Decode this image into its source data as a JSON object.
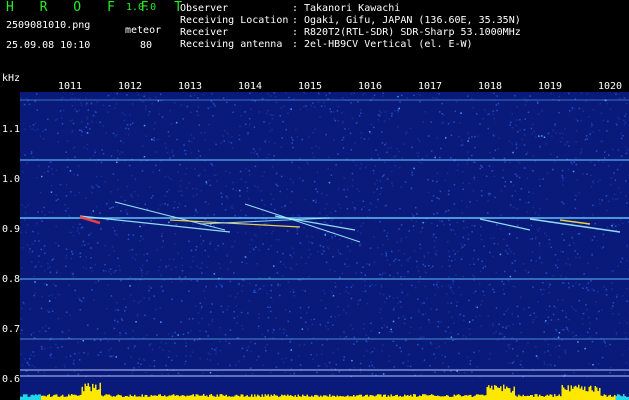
{
  "header": {
    "title": "H R O F F T",
    "version": "1.0.0",
    "filename": "2509081010.png",
    "category": "meteor",
    "datetime": "25.09.08 10:10",
    "count": "80"
  },
  "info": {
    "observer_label": "Observer",
    "observer_value": "Takanori Kawachi",
    "location_label": "Receiving Location",
    "location_value": "Ogaki, Gifu, JAPAN (136.60E, 35.35N)",
    "receiver_label": "Receiver",
    "receiver_value": "R820T2(RTL-SDR) SDR-Sharp 53.1000MHz",
    "antenna_label": "Receiving antenna",
    "antenna_value": "2el-HB9CV Vertical (el. E-W)",
    "colon": ":"
  },
  "axis": {
    "unit": "kHz",
    "x_ticks": [
      "1011",
      "1012",
      "1013",
      "1014",
      "1015",
      "1016",
      "1017",
      "1018",
      "1019",
      "1020"
    ],
    "y_ticks": [
      "1.1",
      "1.0",
      "0.9",
      "0.8",
      "0.7",
      "0.6"
    ]
  },
  "colors": {
    "background": "#000000",
    "spectrum_bg": "#0a1a7a",
    "noise": "#1f4fd0",
    "carrier_line": "#66c8ff",
    "meteor_trace": "#9ff0ff",
    "meteor_core": "#ffe04a",
    "meteor_hot": "#ff4040",
    "bar_yellow": "#ffe800",
    "bar_cyan": "#22d8e8",
    "header_green": "#22ee22"
  }
}
